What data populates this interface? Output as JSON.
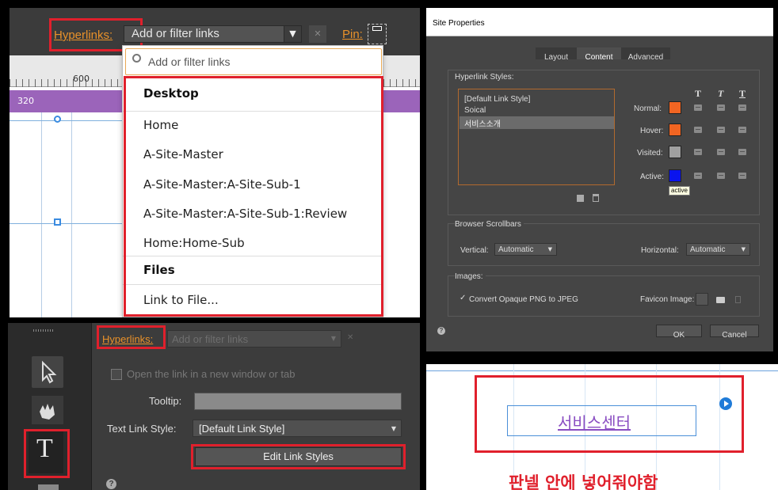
{
  "top_left": {
    "hyperlinks_label": "Hyperlinks:",
    "dropdown_value": "Add or filter links",
    "close_glyph": "✕",
    "pin_label": "Pin:",
    "ruler_600": "600",
    "ruler_320": "320",
    "search_placeholder": "Add or filter links",
    "desktop_header": "Desktop",
    "pages": [
      "Home",
      "A-Site-Master",
      "A-Site-Master:A-Site-Sub-1",
      "A-Site-Master:A-Site-Sub-1:Review",
      "Home:Home-Sub"
    ],
    "files_header": "Files",
    "link_to_file": "Link to File..."
  },
  "site_properties": {
    "title": "Site Properties",
    "tabs": [
      "Layout",
      "Content",
      "Advanced"
    ],
    "hyperlink_styles_label": "Hyperlink Styles:",
    "styles": [
      "[Default Link Style]",
      "Soical",
      "서비스소개"
    ],
    "format_glyphs": [
      "T",
      "T",
      "T"
    ],
    "states": [
      "Normal:",
      "Hover:",
      "Visited:",
      "Active:"
    ],
    "state_colors": [
      "#f26522",
      "#f26522",
      "#a0a0a0",
      "#0a14ee"
    ],
    "tooltip": "active",
    "browser_scrollbars_label": "Browser Scrollbars",
    "vertical_label": "Vertical:",
    "vertical_value": "Automatic",
    "horizontal_label": "Horizontal:",
    "horizontal_value": "Automatic",
    "images_label": "Images:",
    "convert_png_label": "Convert Opaque PNG to JPEG",
    "favicon_label": "Favicon Image:",
    "ok": "OK",
    "cancel": "Cancel",
    "help": "?"
  },
  "bottom_left": {
    "hyperlinks_label": "Hyperlinks:",
    "dropdown_placeholder": "Add or filter links",
    "open_new_window": "Open the link in a new window or tab",
    "tooltip_label": "Tooltip:",
    "text_link_style_label": "Text Link Style:",
    "text_link_style_value": "[Default Link Style]",
    "edit_link_styles": "Edit Link Styles",
    "help": "?"
  },
  "bottom_right": {
    "link_text": "서비스센터",
    "note": "판넬 안에 넣어줘야함"
  }
}
